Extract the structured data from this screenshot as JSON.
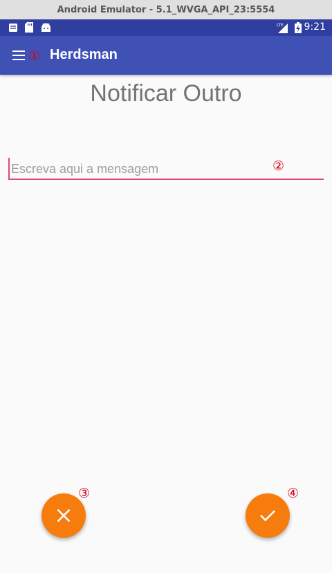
{
  "window": {
    "title": "Android Emulator - 5.1_WVGA_API_23:5554"
  },
  "status_bar": {
    "time": "9:21",
    "network": "LTE",
    "left_icons": [
      "notification-card-icon",
      "sd-card-icon",
      "android-icon"
    ]
  },
  "toolbar": {
    "title": "Herdsman",
    "menu_icon": "hamburger-menu-icon"
  },
  "annotations": {
    "a1": "①",
    "a2": "②",
    "a3": "③",
    "a4": "④"
  },
  "page": {
    "title": "Notificar Outro",
    "message_input": {
      "placeholder": "Escreva aqui a mensagem",
      "value": ""
    }
  },
  "actions": {
    "cancel_icon": "close-icon",
    "confirm_icon": "check-icon"
  },
  "colors": {
    "status_bar": "#303f9f",
    "toolbar": "#3f51b5",
    "accent": "#e0457b",
    "fab": "#f57c0d",
    "annotation": "#d7001b"
  }
}
